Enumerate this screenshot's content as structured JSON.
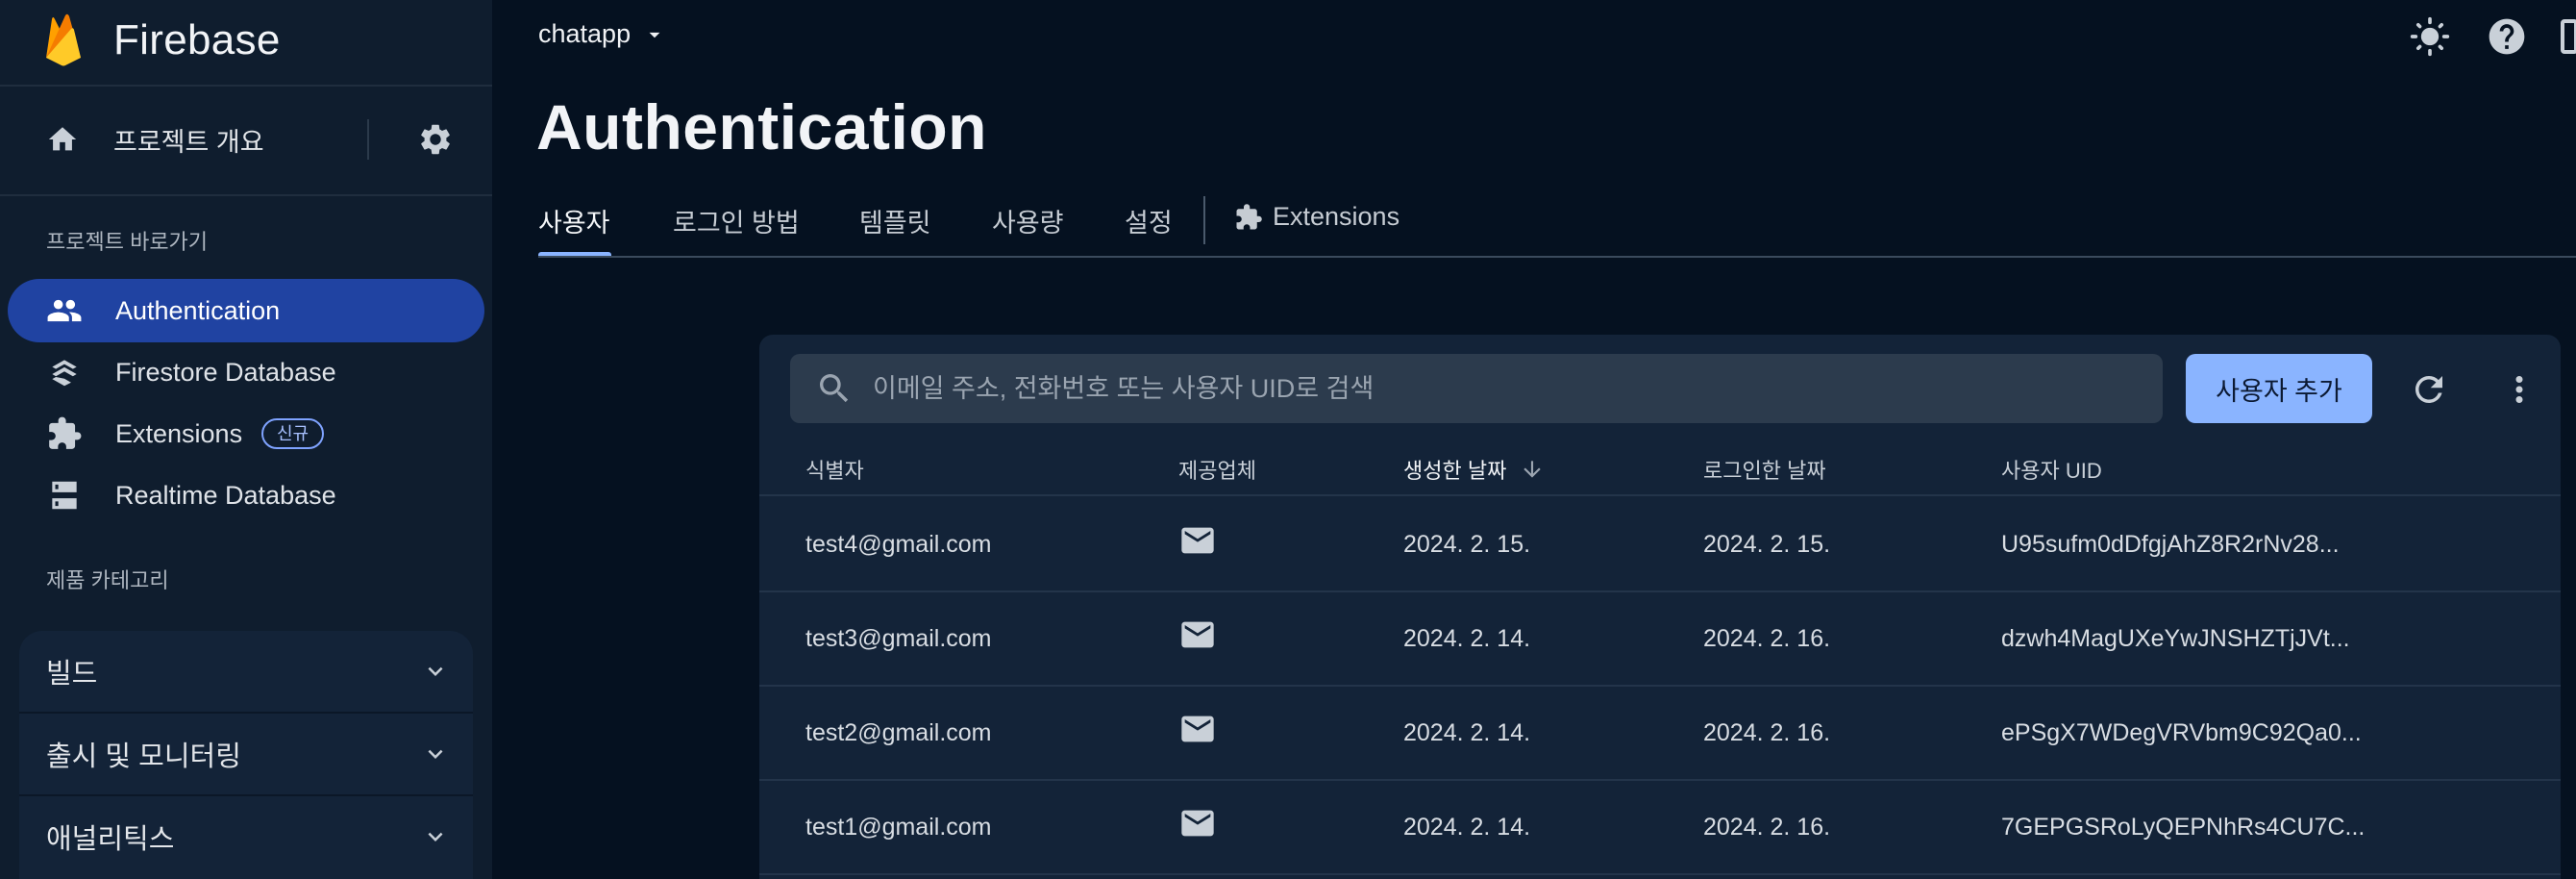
{
  "brand": {
    "name": "Firebase"
  },
  "sidebar": {
    "overview_label": "프로젝트 개요",
    "shortcuts_label": "프로젝트 바로가기",
    "items": [
      {
        "label": "Authentication",
        "icon": "people-icon",
        "active": true
      },
      {
        "label": "Firestore Database",
        "icon": "firestore-icon"
      },
      {
        "label": "Extensions",
        "icon": "extension-icon",
        "badge": "신규"
      },
      {
        "label": "Realtime Database",
        "icon": "database-icon"
      }
    ],
    "categories_label": "제품 카테고리",
    "categories": [
      {
        "label": "빌드"
      },
      {
        "label": "출시 및 모니터링"
      },
      {
        "label": "애널리틱스"
      }
    ]
  },
  "header": {
    "project": "chatapp",
    "title": "Authentication"
  },
  "tabs": [
    {
      "label": "사용자",
      "active": true
    },
    {
      "label": "로그인 방법"
    },
    {
      "label": "템플릿"
    },
    {
      "label": "사용량"
    },
    {
      "label": "설정"
    },
    {
      "label": "Extensions",
      "icon": "extension-icon"
    }
  ],
  "users": {
    "search_placeholder": "이메일 주소, 전화번호 또는 사용자 UID로 검색",
    "add_button": "사용자 추가",
    "columns": [
      "식별자",
      "제공업체",
      "생성한 날짜",
      "로그인한 날짜",
      "사용자 UID"
    ],
    "rows": [
      {
        "identifier": "test4@gmail.com",
        "provider": "email-icon",
        "created": "2024. 2. 15.",
        "signed_in": "2024. 2. 15.",
        "uid": "U95sufm0dDfgjAhZ8R2rNv28..."
      },
      {
        "identifier": "test3@gmail.com",
        "provider": "email-icon",
        "created": "2024. 2. 14.",
        "signed_in": "2024. 2. 16.",
        "uid": "dzwh4MagUXeYwJNSHZTjJVt..."
      },
      {
        "identifier": "test2@gmail.com",
        "provider": "email-icon",
        "created": "2024. 2. 14.",
        "signed_in": "2024. 2. 16.",
        "uid": "ePSgX7WDegVRVbm9C92Qa0..."
      },
      {
        "identifier": "test1@gmail.com",
        "provider": "email-icon",
        "created": "2024. 2. 14.",
        "signed_in": "2024. 2. 16.",
        "uid": "7GEPGSRoLyQEPNhRs4CU7C..."
      }
    ]
  },
  "colors": {
    "accent": "#8ab4ff",
    "active_nav": "#2043a2",
    "background": "#051120",
    "sidebar": "#0f1d2e",
    "card": "#132338"
  }
}
